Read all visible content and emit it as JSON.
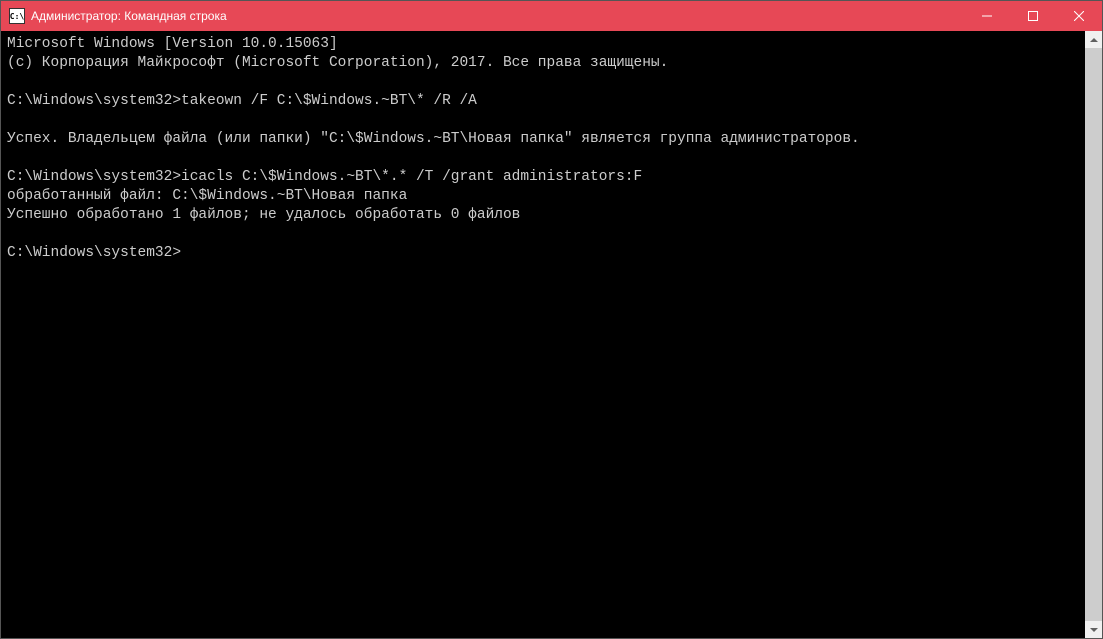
{
  "titlebar": {
    "icon_text": "C:\\",
    "title": "Администратор: Командная строка"
  },
  "terminal": {
    "lines": [
      "Microsoft Windows [Version 10.0.15063]",
      "(c) Корпорация Майкрософт (Microsoft Corporation), 2017. Все права защищены.",
      "",
      "C:\\Windows\\system32>takeown /F C:\\$Windows.~BT\\* /R /A",
      "",
      "Успех. Владельцем файла (или папки) \"C:\\$Windows.~BT\\Новая папка\" является группа администраторов.",
      "",
      "C:\\Windows\\system32>icacls C:\\$Windows.~BT\\*.* /T /grant administrators:F",
      "обработанный файл: C:\\$Windows.~BT\\Новая папка",
      "Успешно обработано 1 файлов; не удалось обработать 0 файлов",
      "",
      "C:\\Windows\\system32>"
    ]
  }
}
